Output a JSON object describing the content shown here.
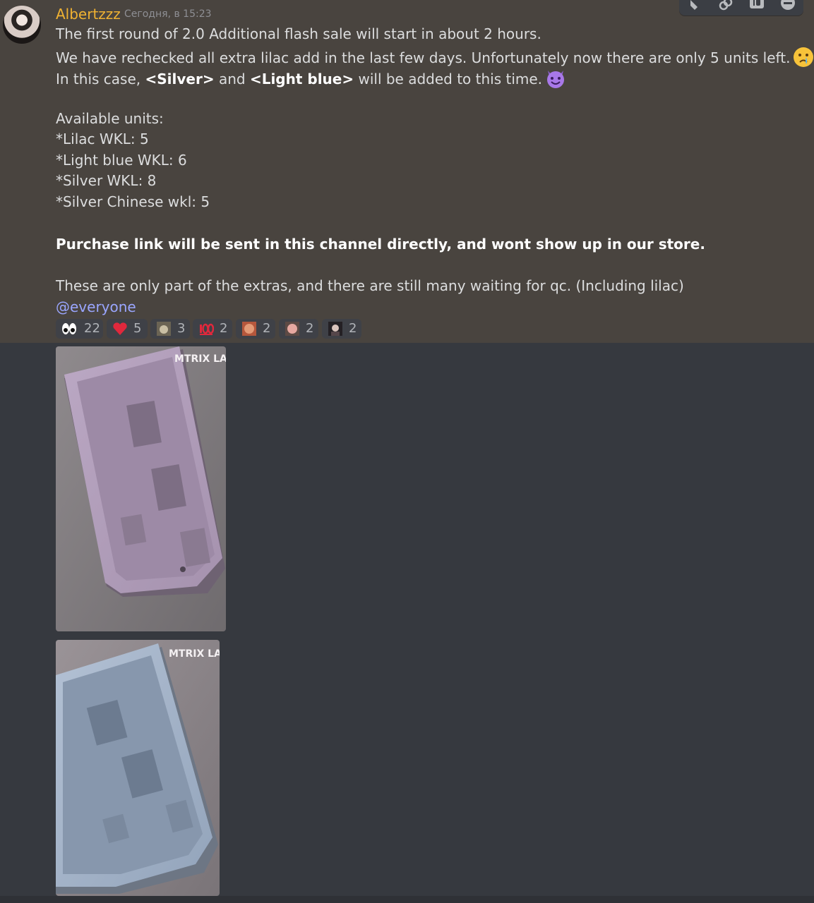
{
  "message": {
    "author": "Albertzzz",
    "timestamp": "Сегодня, в 15:23",
    "lines": [
      "The first round of 2.0 Additional flash sale will start in about 2 hours.",
      "We have rechecked all extra lilac add in the last few days. Unfortunately now there are only 5 units left."
    ],
    "line3_a": "In this case, ",
    "line3_silver": "<Silver>",
    "line3_b": " and ",
    "line3_lightblue": "<Light blue>",
    "line3_c": " will be added to this time.",
    "units_heading": "Available units:",
    "units": [
      "*Lilac WKL: 5",
      "*Light blue WKL: 6",
      "*Silver WKL: 8",
      "*Silver Chinese wkl: 5"
    ],
    "purchase_note": "Purchase link will be sent in this channel directly, and wont show up in our store.",
    "extras_note": "These are only part of the extras, and there are still many waiting for qc. (Including lilac)",
    "mention": "@everyone"
  },
  "reactions": [
    {
      "icon": "eyes-emoji",
      "count": "22"
    },
    {
      "icon": "heart-emoji",
      "count": "5"
    },
    {
      "icon": "custom-cat-emoji",
      "count": "3"
    },
    {
      "icon": "hundred-points-emoji",
      "count": "2"
    },
    {
      "icon": "custom-face-emoji",
      "count": "2"
    },
    {
      "icon": "custom-baby-emoji",
      "count": "2"
    },
    {
      "icon": "custom-portrait-emoji",
      "count": "2"
    }
  ],
  "attachments": [
    {
      "name": "lilac-keyboard-case-photo",
      "logo_text": "MTRIX LAB"
    },
    {
      "name": "light-blue-keyboard-case-photo",
      "logo_text": "MTRIX LAB"
    }
  ],
  "colors": {
    "message_highlight": "#49443f",
    "background": "#36393f",
    "username": "#f0b232",
    "mention": "#9aa6ff"
  }
}
